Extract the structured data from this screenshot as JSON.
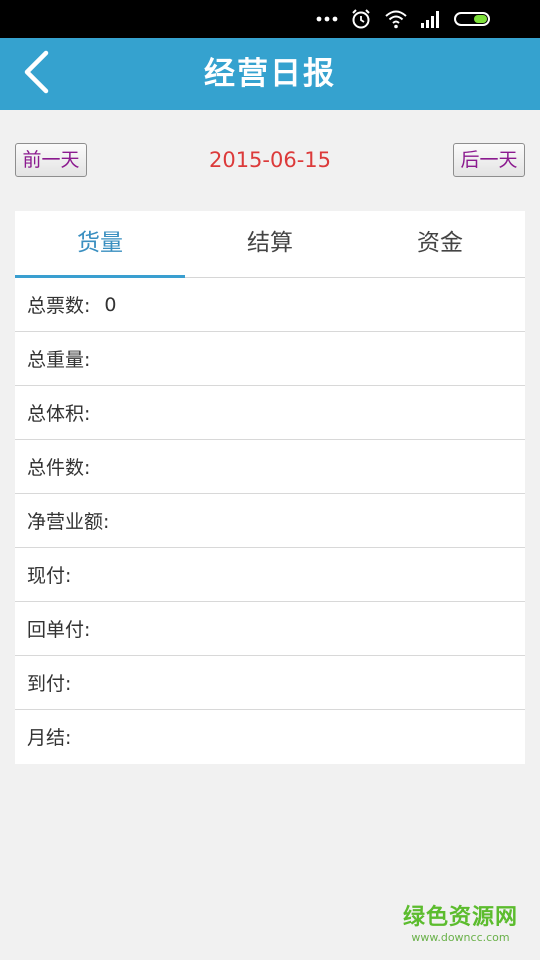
{
  "status_bar": {
    "icons": [
      "more-dots-icon",
      "alarm-icon",
      "wifi-icon",
      "signal-icon",
      "battery-icon"
    ],
    "battery_color": "#7ddf3a"
  },
  "header": {
    "title": "经营日报",
    "back_icon": "chevron-left-icon",
    "background_color": "#35a2cf"
  },
  "date_nav": {
    "prev_label": "前一天",
    "date": "2015-06-15",
    "next_label": "后一天",
    "date_color": "#dc3a3a"
  },
  "tabs": [
    {
      "label": "货量",
      "active": true
    },
    {
      "label": "结算",
      "active": false
    },
    {
      "label": "资金",
      "active": false
    }
  ],
  "rows": [
    {
      "label": "总票数:",
      "value": "0"
    },
    {
      "label": "总重量:",
      "value": ""
    },
    {
      "label": "总体积:",
      "value": ""
    },
    {
      "label": "总件数:",
      "value": ""
    },
    {
      "label": "净营业额:",
      "value": ""
    },
    {
      "label": "现付:",
      "value": ""
    },
    {
      "label": "回单付:",
      "value": ""
    },
    {
      "label": "到付:",
      "value": ""
    },
    {
      "label": "月结:",
      "value": ""
    }
  ],
  "watermark": {
    "main": "绿色资源网",
    "sub": "www.downcc.com"
  }
}
